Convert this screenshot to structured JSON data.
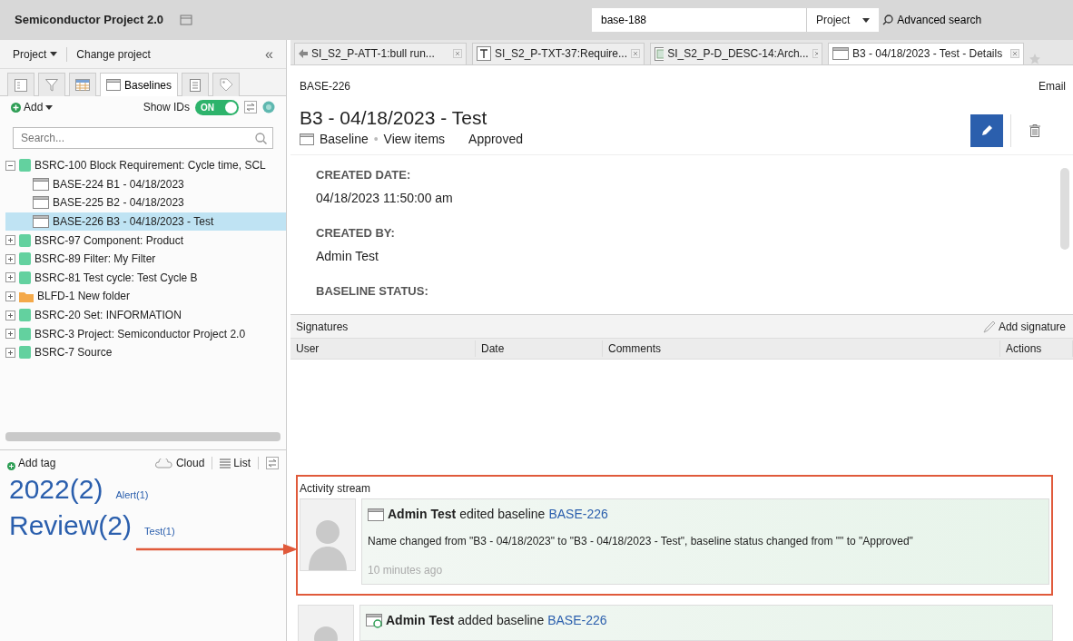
{
  "app": {
    "title": "Semiconductor Project 2.0"
  },
  "search": {
    "value": "base-188",
    "scope": "Project",
    "advanced": "Advanced search"
  },
  "left_toolbar": {
    "project_menu": "Project",
    "change_project": "Change project",
    "collapse": "«"
  },
  "view_tabs": [
    {
      "kind": "outline",
      "selected": false
    },
    {
      "kind": "filter",
      "selected": false
    },
    {
      "kind": "grid",
      "selected": false
    },
    {
      "kind": "baseline",
      "label": "Baselines",
      "selected": true
    },
    {
      "kind": "document",
      "selected": false
    },
    {
      "kind": "tag",
      "selected": false
    }
  ],
  "tree_toolbar": {
    "add": "Add",
    "show_ids_label": "Show IDs",
    "show_ids_on": true,
    "show_ids_text": "ON"
  },
  "tree_search": {
    "placeholder": "Search..."
  },
  "tree": [
    {
      "kind": "source",
      "label": "BSRC-100 Block Requirement: Cycle time, SCL",
      "expanded": true,
      "selected": false,
      "children": [
        {
          "kind": "baseline",
          "label": "BASE-224 B1 - 04/18/2023",
          "selected": false
        },
        {
          "kind": "baseline",
          "label": "BASE-225 B2 - 04/18/2023",
          "selected": false
        },
        {
          "kind": "baseline",
          "label": "BASE-226 B3 - 04/18/2023 - Test",
          "selected": true
        }
      ]
    },
    {
      "kind": "source",
      "label": "BSRC-97 Component: Product",
      "expanded": false,
      "selected": false
    },
    {
      "kind": "source",
      "label": "BSRC-89 Filter: My Filter",
      "expanded": false,
      "selected": false
    },
    {
      "kind": "source",
      "label": "BSRC-81 Test cycle: Test Cycle B",
      "expanded": false,
      "selected": false
    },
    {
      "kind": "folder",
      "label": "BLFD-1 New folder",
      "expanded": false,
      "selected": false
    },
    {
      "kind": "source",
      "label": "BSRC-20 Set: INFORMATION",
      "expanded": false,
      "selected": false
    },
    {
      "kind": "source",
      "label": "BSRC-3 Project: Semiconductor Project 2.0",
      "expanded": false,
      "selected": false
    },
    {
      "kind": "source",
      "label": "BSRC-7 Source",
      "expanded": false,
      "selected": false
    }
  ],
  "tag_toolbar": {
    "add": "Add tag",
    "cloud": "Cloud",
    "list": "List"
  },
  "tag_rows": [
    [
      {
        "label": "2022(2)",
        "kind": "large"
      },
      {
        "label": "Alert(1)",
        "kind": "small"
      }
    ],
    [
      {
        "label": "Review(2)",
        "kind": "large"
      },
      {
        "label": "Test(1)",
        "kind": "small"
      }
    ]
  ],
  "tabs": [
    {
      "kind": "attachment",
      "label": "SI_S2_P-ATT-1:bull run...",
      "selected": false
    },
    {
      "kind": "text",
      "label": "SI_S2_P-TXT-37:Require...",
      "selected": false
    },
    {
      "kind": "diagram",
      "label": "SI_S2_P-D_DESC-14:Arch...",
      "selected": false
    },
    {
      "kind": "baseline",
      "label": "B3 - 04/18/2023 - Test - Details",
      "selected": true
    }
  ],
  "detail": {
    "id": "BASE-226",
    "email": "Email",
    "title": "B3 - 04/18/2023 - Test",
    "type": "Baseline",
    "separator": "•",
    "view_items": "View items",
    "status": "Approved",
    "fields": [
      {
        "label": "CREATED DATE:",
        "value": "04/18/2023 11:50:00 am"
      },
      {
        "label": "CREATED BY:",
        "value": "Admin Test"
      },
      {
        "label": "BASELINE STATUS:"
      }
    ]
  },
  "signatures": {
    "title": "Signatures",
    "add": "Add signature",
    "columns": [
      "User",
      "Date",
      "Comments",
      "Actions"
    ]
  },
  "activity": {
    "title": "Activity stream",
    "annotated": true,
    "entries": [
      {
        "kind": "edited",
        "user": "Admin Test",
        "action": "edited baseline",
        "link": "BASE-226",
        "detail": "Name changed from \"B3 - 04/18/2023\" to \"B3 - 04/18/2023 - Test\", baseline status changed from \"\" to \"Approved\"",
        "time": "10 minutes ago"
      },
      {
        "kind": "added",
        "user": "Admin Test",
        "action": "added baseline",
        "link": "BASE-226"
      }
    ]
  }
}
